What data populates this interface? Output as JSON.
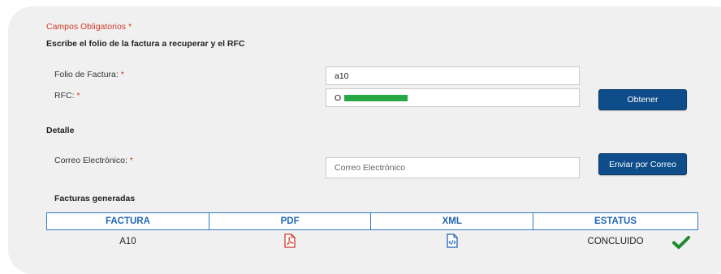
{
  "form": {
    "required_title": "Campos Obligatorios",
    "required_star": "*",
    "instruction": "Escribe el folio de la factura a recuperar y el RFC",
    "folio_label": "Folio de Factura:",
    "folio_value": "a10",
    "rfc_label": "RFC:",
    "rfc_value_visible": "O",
    "obtain_button": "Obtener"
  },
  "detail": {
    "section_title": "Detalle",
    "email_label": "Correo Electrónico:",
    "email_placeholder": "Correo Electrónico",
    "send_button": "Enviar por Correo",
    "invoices_title": "Facturas generadas"
  },
  "table": {
    "headers": [
      "FACTURA",
      "PDF",
      "XML",
      "ESTATUS"
    ],
    "rows": [
      {
        "factura": "A10",
        "pdf_icon": "pdf-file-icon",
        "xml_icon": "xml-code-file-icon",
        "estatus": "CONCLUIDO"
      }
    ]
  },
  "colors": {
    "accent_blue": "#0e4d8a",
    "header_blue": "#1f66b3",
    "required_red": "#d23b2b",
    "success_green": "#1f8a2e",
    "mask_green": "#28a745"
  }
}
